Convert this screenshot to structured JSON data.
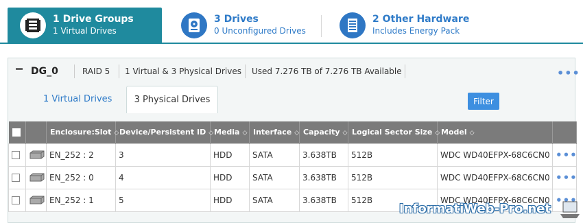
{
  "tabs": [
    {
      "title": "1 Drive Groups",
      "subtitle": "1 Virtual Drives",
      "icon": "drive-groups-icon"
    },
    {
      "title": "3 Drives",
      "subtitle": "0 Unconfigured Drives",
      "icon": "hard-drive-icon"
    },
    {
      "title": "2 Other Hardware",
      "subtitle": "Includes Energy Pack",
      "icon": "server-icon"
    }
  ],
  "drive_group": {
    "name": "DG_0",
    "raid": "RAID 5",
    "summary": "1 Virtual & 3 Physical Drives",
    "usage": "Used 7.276 TB of 7.276 TB Available",
    "more": "•••"
  },
  "sub_tabs": {
    "virtual": "1 Virtual Drives",
    "physical": "3 Physical Drives"
  },
  "filter_label": "Filter",
  "table": {
    "headers": [
      "Enclosure:Slot",
      "Device/Persistent ID",
      "Media",
      "Interface",
      "Capacity",
      "Logical Sector Size",
      "Model"
    ],
    "rows": [
      {
        "slot": "EN_252 : 2",
        "id": "3",
        "media": "HDD",
        "interface": "SATA",
        "capacity": "3.638TB",
        "sector": "512B",
        "model": "WDC WD40EFPX-68C6CN0"
      },
      {
        "slot": "EN_252 : 0",
        "id": "4",
        "media": "HDD",
        "interface": "SATA",
        "capacity": "3.638TB",
        "sector": "512B",
        "model": "WDC WD40EFPX-68C6CN0"
      },
      {
        "slot": "EN_252 : 1",
        "id": "5",
        "media": "HDD",
        "interface": "SATA",
        "capacity": "3.638TB",
        "sector": "512B",
        "model": "WDC WD40EFPX-68C6CN0"
      }
    ],
    "row_more": "•••"
  },
  "watermark": "InformatiWeb-Pro.net",
  "colors": {
    "accent": "#1f8a9e",
    "link": "#2f7bc8",
    "header": "#7b7b7b",
    "button": "#3d8fe0"
  }
}
